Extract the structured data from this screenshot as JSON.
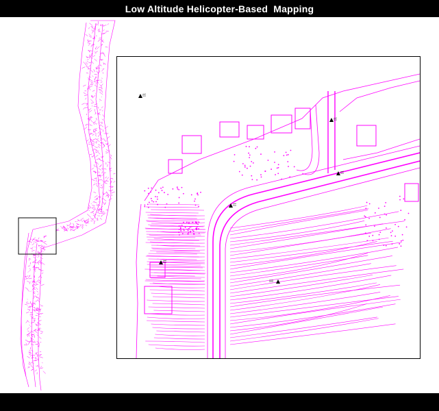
{
  "header": {
    "title": "Low Altitude Helicopter-Based  Mapping",
    "background_color": "#000000",
    "text_color": "#ffffff"
  },
  "map": {
    "linework_color": "#ff00ff",
    "symbol_color": "#000000",
    "overview_map": {
      "description_icon": "corridor-strip-map"
    },
    "locator_box": {
      "icon": "extent-rectangle"
    },
    "detail_inset": {
      "icon": "zoomed-planimetric-map"
    },
    "control_points": {
      "icon": "triangle-benchmark-symbol"
    }
  }
}
